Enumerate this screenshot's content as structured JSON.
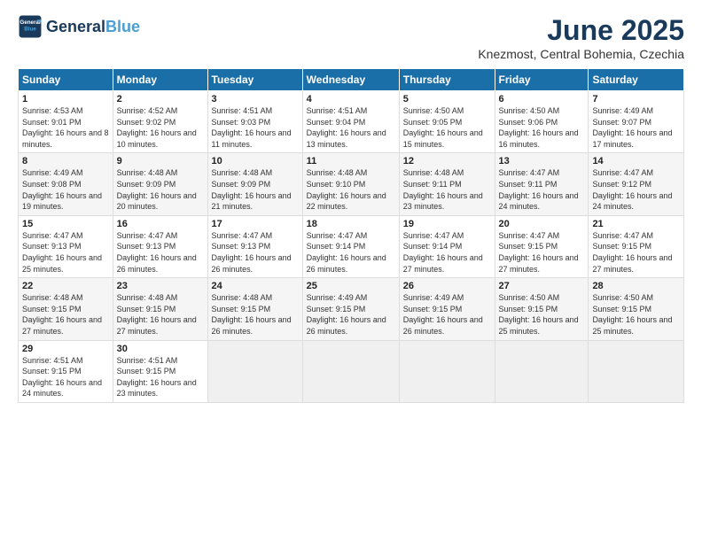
{
  "logo": {
    "line1": "General",
    "line2": "Blue"
  },
  "title": "June 2025",
  "subtitle": "Knezmost, Central Bohemia, Czechia",
  "weekdays": [
    "Sunday",
    "Monday",
    "Tuesday",
    "Wednesday",
    "Thursday",
    "Friday",
    "Saturday"
  ],
  "weeks": [
    [
      {
        "day": "1",
        "sunrise": "Sunrise: 4:53 AM",
        "sunset": "Sunset: 9:01 PM",
        "daylight": "Daylight: 16 hours and 8 minutes."
      },
      {
        "day": "2",
        "sunrise": "Sunrise: 4:52 AM",
        "sunset": "Sunset: 9:02 PM",
        "daylight": "Daylight: 16 hours and 10 minutes."
      },
      {
        "day": "3",
        "sunrise": "Sunrise: 4:51 AM",
        "sunset": "Sunset: 9:03 PM",
        "daylight": "Daylight: 16 hours and 11 minutes."
      },
      {
        "day": "4",
        "sunrise": "Sunrise: 4:51 AM",
        "sunset": "Sunset: 9:04 PM",
        "daylight": "Daylight: 16 hours and 13 minutes."
      },
      {
        "day": "5",
        "sunrise": "Sunrise: 4:50 AM",
        "sunset": "Sunset: 9:05 PM",
        "daylight": "Daylight: 16 hours and 15 minutes."
      },
      {
        "day": "6",
        "sunrise": "Sunrise: 4:50 AM",
        "sunset": "Sunset: 9:06 PM",
        "daylight": "Daylight: 16 hours and 16 minutes."
      },
      {
        "day": "7",
        "sunrise": "Sunrise: 4:49 AM",
        "sunset": "Sunset: 9:07 PM",
        "daylight": "Daylight: 16 hours and 17 minutes."
      }
    ],
    [
      {
        "day": "8",
        "sunrise": "Sunrise: 4:49 AM",
        "sunset": "Sunset: 9:08 PM",
        "daylight": "Daylight: 16 hours and 19 minutes."
      },
      {
        "day": "9",
        "sunrise": "Sunrise: 4:48 AM",
        "sunset": "Sunset: 9:09 PM",
        "daylight": "Daylight: 16 hours and 20 minutes."
      },
      {
        "day": "10",
        "sunrise": "Sunrise: 4:48 AM",
        "sunset": "Sunset: 9:09 PM",
        "daylight": "Daylight: 16 hours and 21 minutes."
      },
      {
        "day": "11",
        "sunrise": "Sunrise: 4:48 AM",
        "sunset": "Sunset: 9:10 PM",
        "daylight": "Daylight: 16 hours and 22 minutes."
      },
      {
        "day": "12",
        "sunrise": "Sunrise: 4:48 AM",
        "sunset": "Sunset: 9:11 PM",
        "daylight": "Daylight: 16 hours and 23 minutes."
      },
      {
        "day": "13",
        "sunrise": "Sunrise: 4:47 AM",
        "sunset": "Sunset: 9:11 PM",
        "daylight": "Daylight: 16 hours and 24 minutes."
      },
      {
        "day": "14",
        "sunrise": "Sunrise: 4:47 AM",
        "sunset": "Sunset: 9:12 PM",
        "daylight": "Daylight: 16 hours and 24 minutes."
      }
    ],
    [
      {
        "day": "15",
        "sunrise": "Sunrise: 4:47 AM",
        "sunset": "Sunset: 9:13 PM",
        "daylight": "Daylight: 16 hours and 25 minutes."
      },
      {
        "day": "16",
        "sunrise": "Sunrise: 4:47 AM",
        "sunset": "Sunset: 9:13 PM",
        "daylight": "Daylight: 16 hours and 26 minutes."
      },
      {
        "day": "17",
        "sunrise": "Sunrise: 4:47 AM",
        "sunset": "Sunset: 9:13 PM",
        "daylight": "Daylight: 16 hours and 26 minutes."
      },
      {
        "day": "18",
        "sunrise": "Sunrise: 4:47 AM",
        "sunset": "Sunset: 9:14 PM",
        "daylight": "Daylight: 16 hours and 26 minutes."
      },
      {
        "day": "19",
        "sunrise": "Sunrise: 4:47 AM",
        "sunset": "Sunset: 9:14 PM",
        "daylight": "Daylight: 16 hours and 27 minutes."
      },
      {
        "day": "20",
        "sunrise": "Sunrise: 4:47 AM",
        "sunset": "Sunset: 9:15 PM",
        "daylight": "Daylight: 16 hours and 27 minutes."
      },
      {
        "day": "21",
        "sunrise": "Sunrise: 4:47 AM",
        "sunset": "Sunset: 9:15 PM",
        "daylight": "Daylight: 16 hours and 27 minutes."
      }
    ],
    [
      {
        "day": "22",
        "sunrise": "Sunrise: 4:48 AM",
        "sunset": "Sunset: 9:15 PM",
        "daylight": "Daylight: 16 hours and 27 minutes."
      },
      {
        "day": "23",
        "sunrise": "Sunrise: 4:48 AM",
        "sunset": "Sunset: 9:15 PM",
        "daylight": "Daylight: 16 hours and 27 minutes."
      },
      {
        "day": "24",
        "sunrise": "Sunrise: 4:48 AM",
        "sunset": "Sunset: 9:15 PM",
        "daylight": "Daylight: 16 hours and 26 minutes."
      },
      {
        "day": "25",
        "sunrise": "Sunrise: 4:49 AM",
        "sunset": "Sunset: 9:15 PM",
        "daylight": "Daylight: 16 hours and 26 minutes."
      },
      {
        "day": "26",
        "sunrise": "Sunrise: 4:49 AM",
        "sunset": "Sunset: 9:15 PM",
        "daylight": "Daylight: 16 hours and 26 minutes."
      },
      {
        "day": "27",
        "sunrise": "Sunrise: 4:50 AM",
        "sunset": "Sunset: 9:15 PM",
        "daylight": "Daylight: 16 hours and 25 minutes."
      },
      {
        "day": "28",
        "sunrise": "Sunrise: 4:50 AM",
        "sunset": "Sunset: 9:15 PM",
        "daylight": "Daylight: 16 hours and 25 minutes."
      }
    ],
    [
      {
        "day": "29",
        "sunrise": "Sunrise: 4:51 AM",
        "sunset": "Sunset: 9:15 PM",
        "daylight": "Daylight: 16 hours and 24 minutes."
      },
      {
        "day": "30",
        "sunrise": "Sunrise: 4:51 AM",
        "sunset": "Sunset: 9:15 PM",
        "daylight": "Daylight: 16 hours and 23 minutes."
      },
      null,
      null,
      null,
      null,
      null
    ]
  ]
}
